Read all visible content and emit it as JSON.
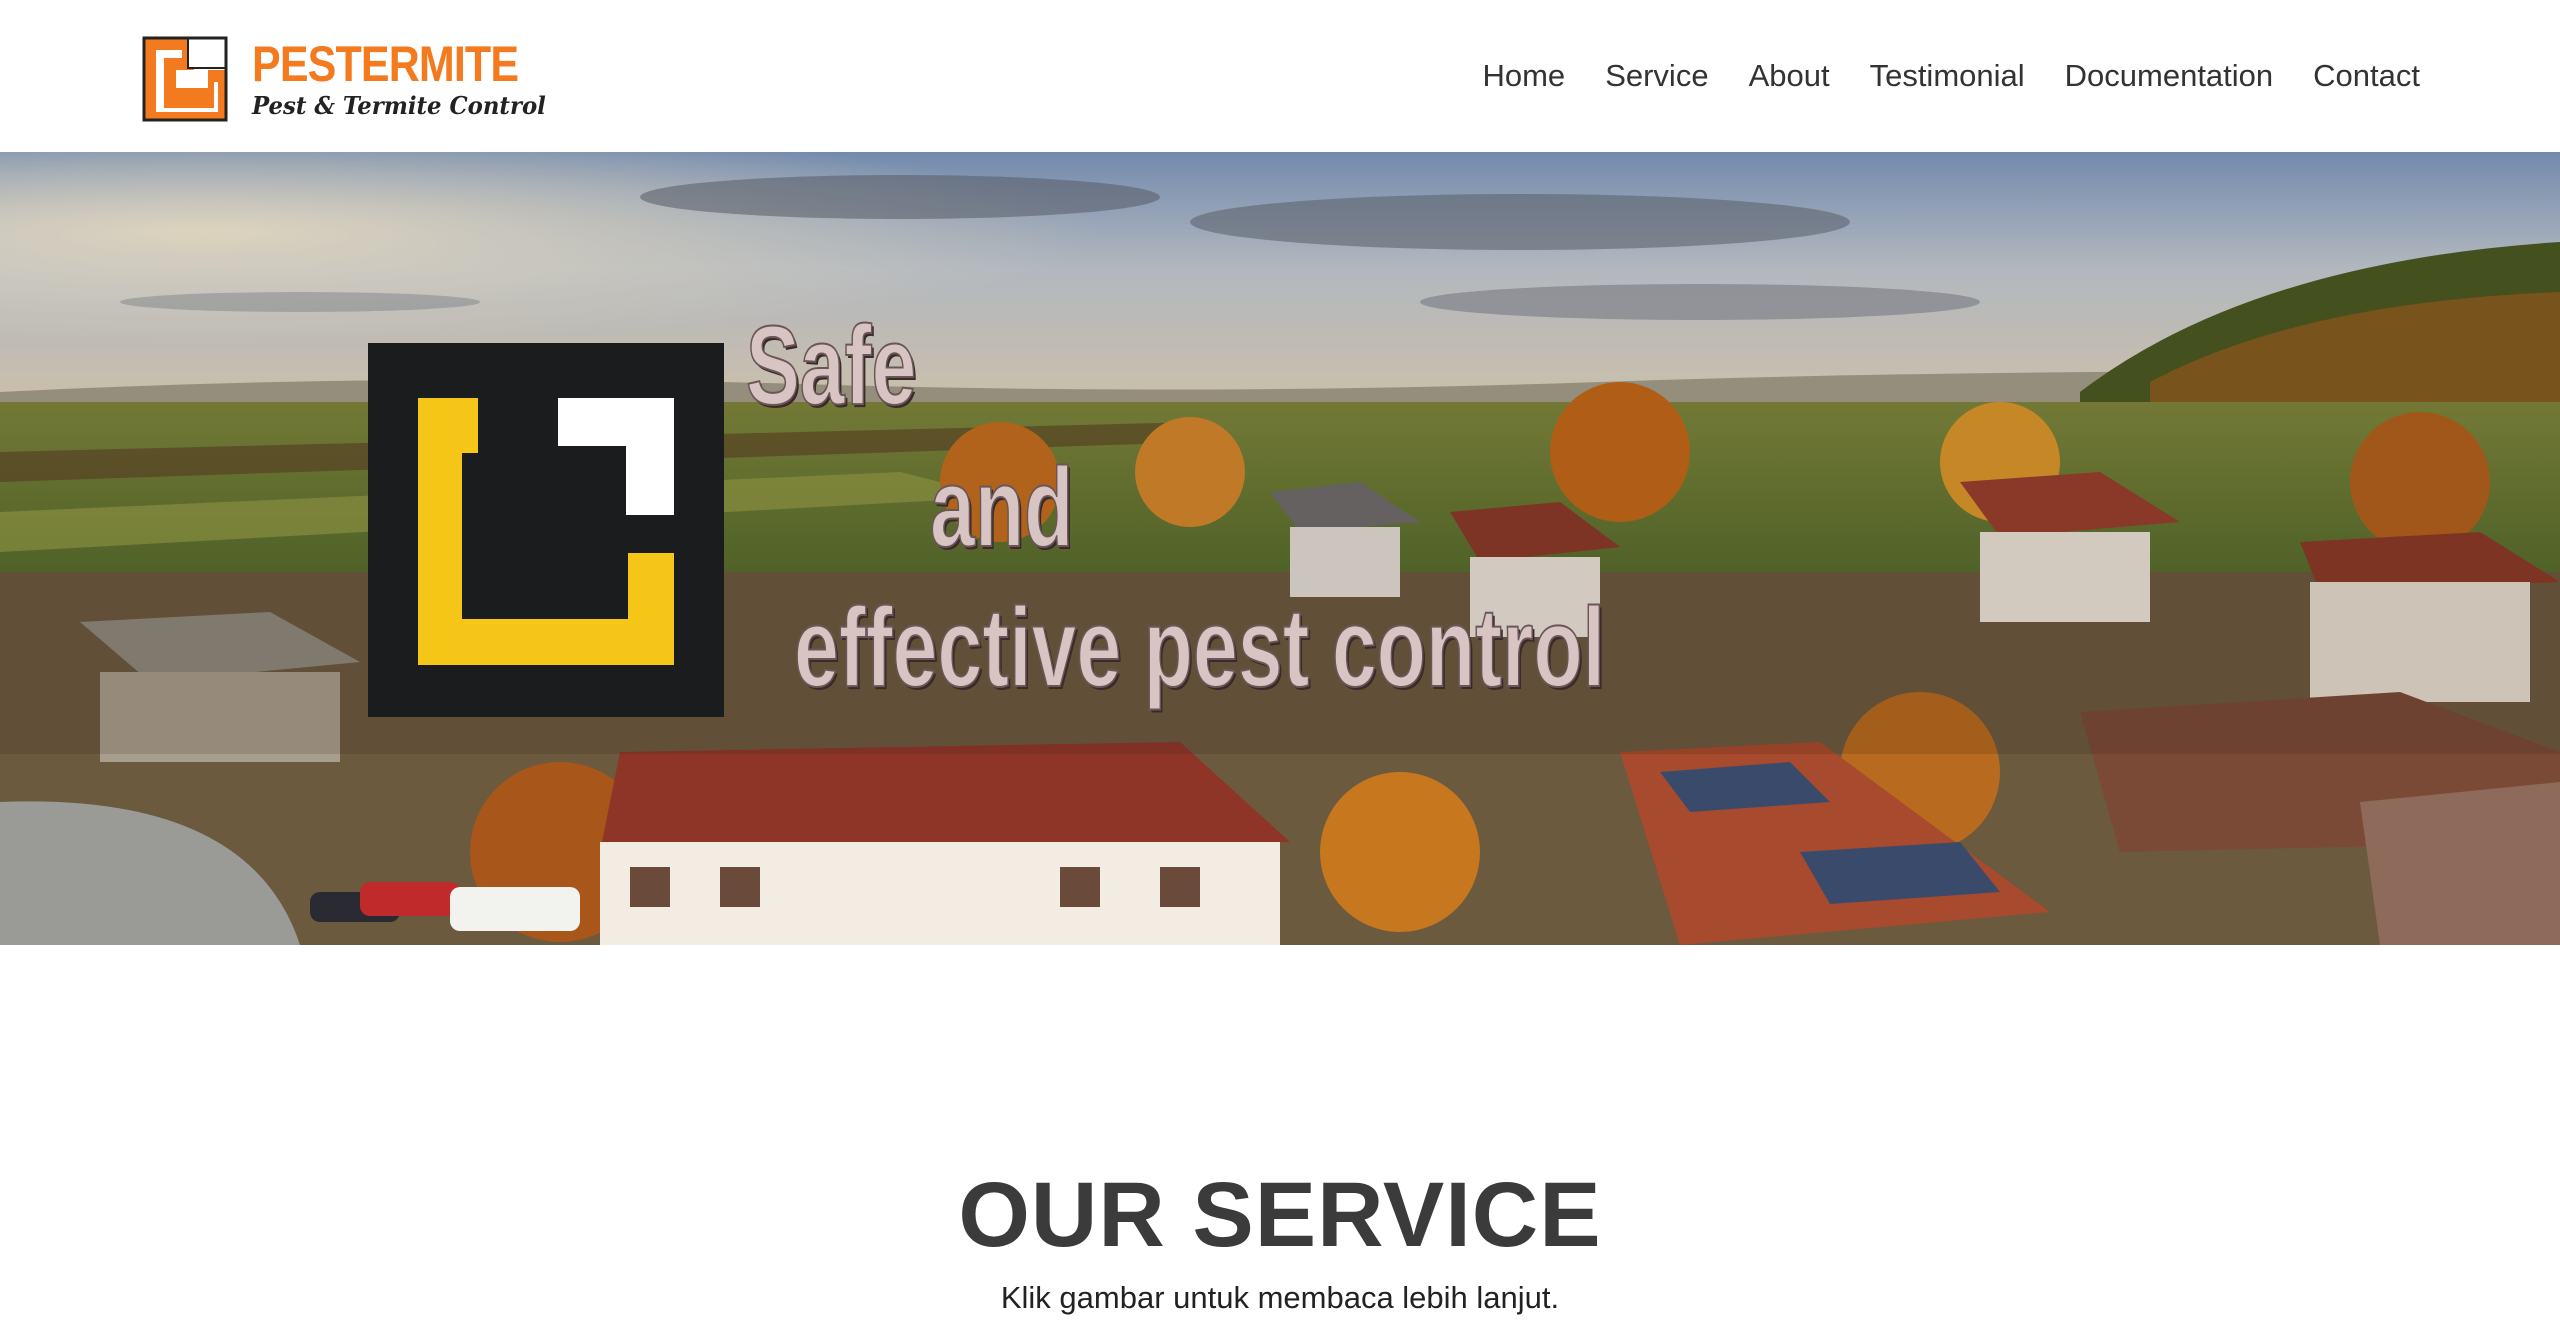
{
  "header": {
    "brand": {
      "name": "PESTERMITE",
      "tagline": "Pest & Termite Control",
      "name_color": "#f47a1f"
    },
    "nav": [
      {
        "label": "Home"
      },
      {
        "label": "Service"
      },
      {
        "label": "About"
      },
      {
        "label": "Testimonial"
      },
      {
        "label": "Documentation"
      },
      {
        "label": "Contact"
      }
    ]
  },
  "hero": {
    "headline_lines": [
      "Safe",
      "and",
      "effective pest control"
    ],
    "logo_colors": {
      "background": "#1b1c1e",
      "bracket": "#f5c518",
      "corner": "#ffffff"
    }
  },
  "service": {
    "title": "OUR SERVICE",
    "subtitle": "Klik gambar untuk membaca lebih lanjut."
  }
}
